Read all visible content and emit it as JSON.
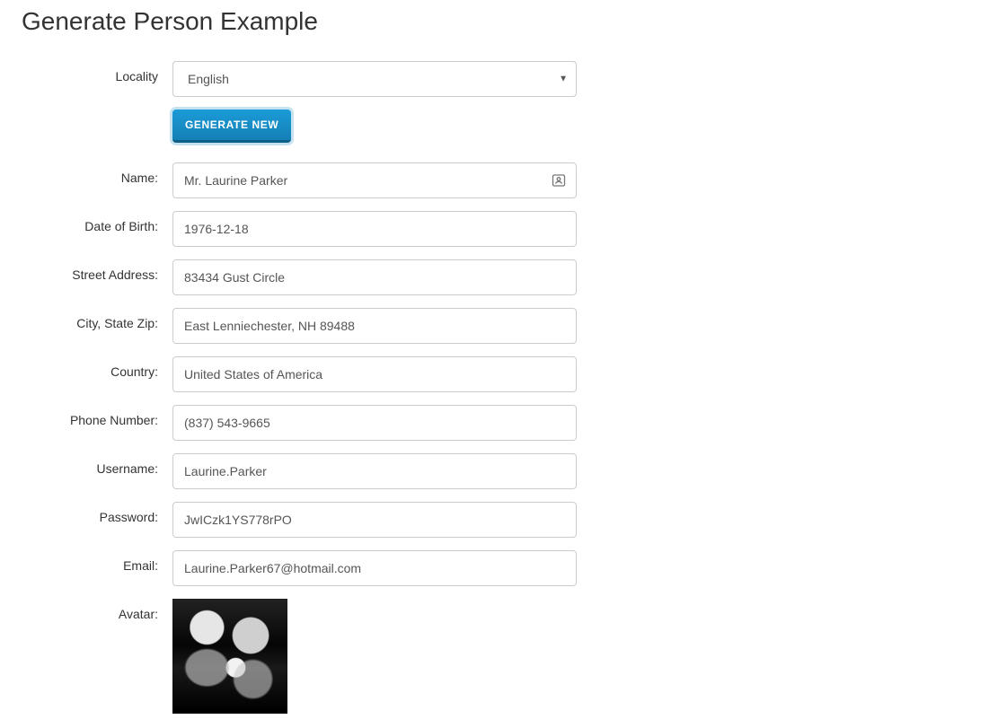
{
  "page": {
    "title": "Generate Person Example"
  },
  "form": {
    "locality": {
      "label": "Locality",
      "value": "English"
    },
    "generate_button": "GENERATE NEW",
    "fields": {
      "name": {
        "label": "Name:",
        "value": "Mr. Laurine Parker"
      },
      "dob": {
        "label": "Date of Birth:",
        "value": "1976-12-18"
      },
      "street": {
        "label": "Street Address:",
        "value": "83434 Gust Circle"
      },
      "city_state_zip": {
        "label": "City, State Zip:",
        "value": "East Lenniechester, NH 89488"
      },
      "country": {
        "label": "Country:",
        "value": "United States of America"
      },
      "phone": {
        "label": "Phone Number:",
        "value": "(837) 543-9665"
      },
      "username": {
        "label": "Username:",
        "value": "Laurine.Parker"
      },
      "password": {
        "label": "Password:",
        "value": "JwICzk1YS778rPO"
      },
      "email": {
        "label": "Email:",
        "value": "Laurine.Parker67@hotmail.com"
      },
      "avatar": {
        "label": "Avatar:"
      }
    }
  },
  "icons": {
    "contact_card": "contact-card-icon",
    "dropdown": "▼"
  }
}
